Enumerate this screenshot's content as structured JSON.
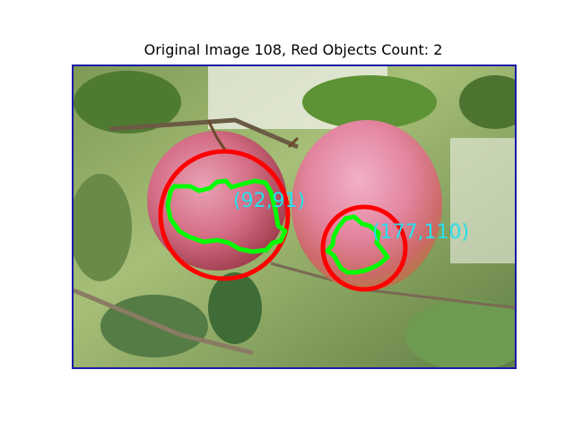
{
  "figure": {
    "title": "Original Image 108, Red Objects Count: 2"
  },
  "detections": [
    {
      "label": "(92,91)",
      "circle_color": "#ff0000",
      "contour_color": "#00ff00"
    },
    {
      "label": "(177,110)",
      "circle_color": "#ff0000",
      "contour_color": "#00ff00"
    }
  ],
  "colors": {
    "frame_border": "#1a1aa8",
    "label_text": "#29e1f0"
  }
}
